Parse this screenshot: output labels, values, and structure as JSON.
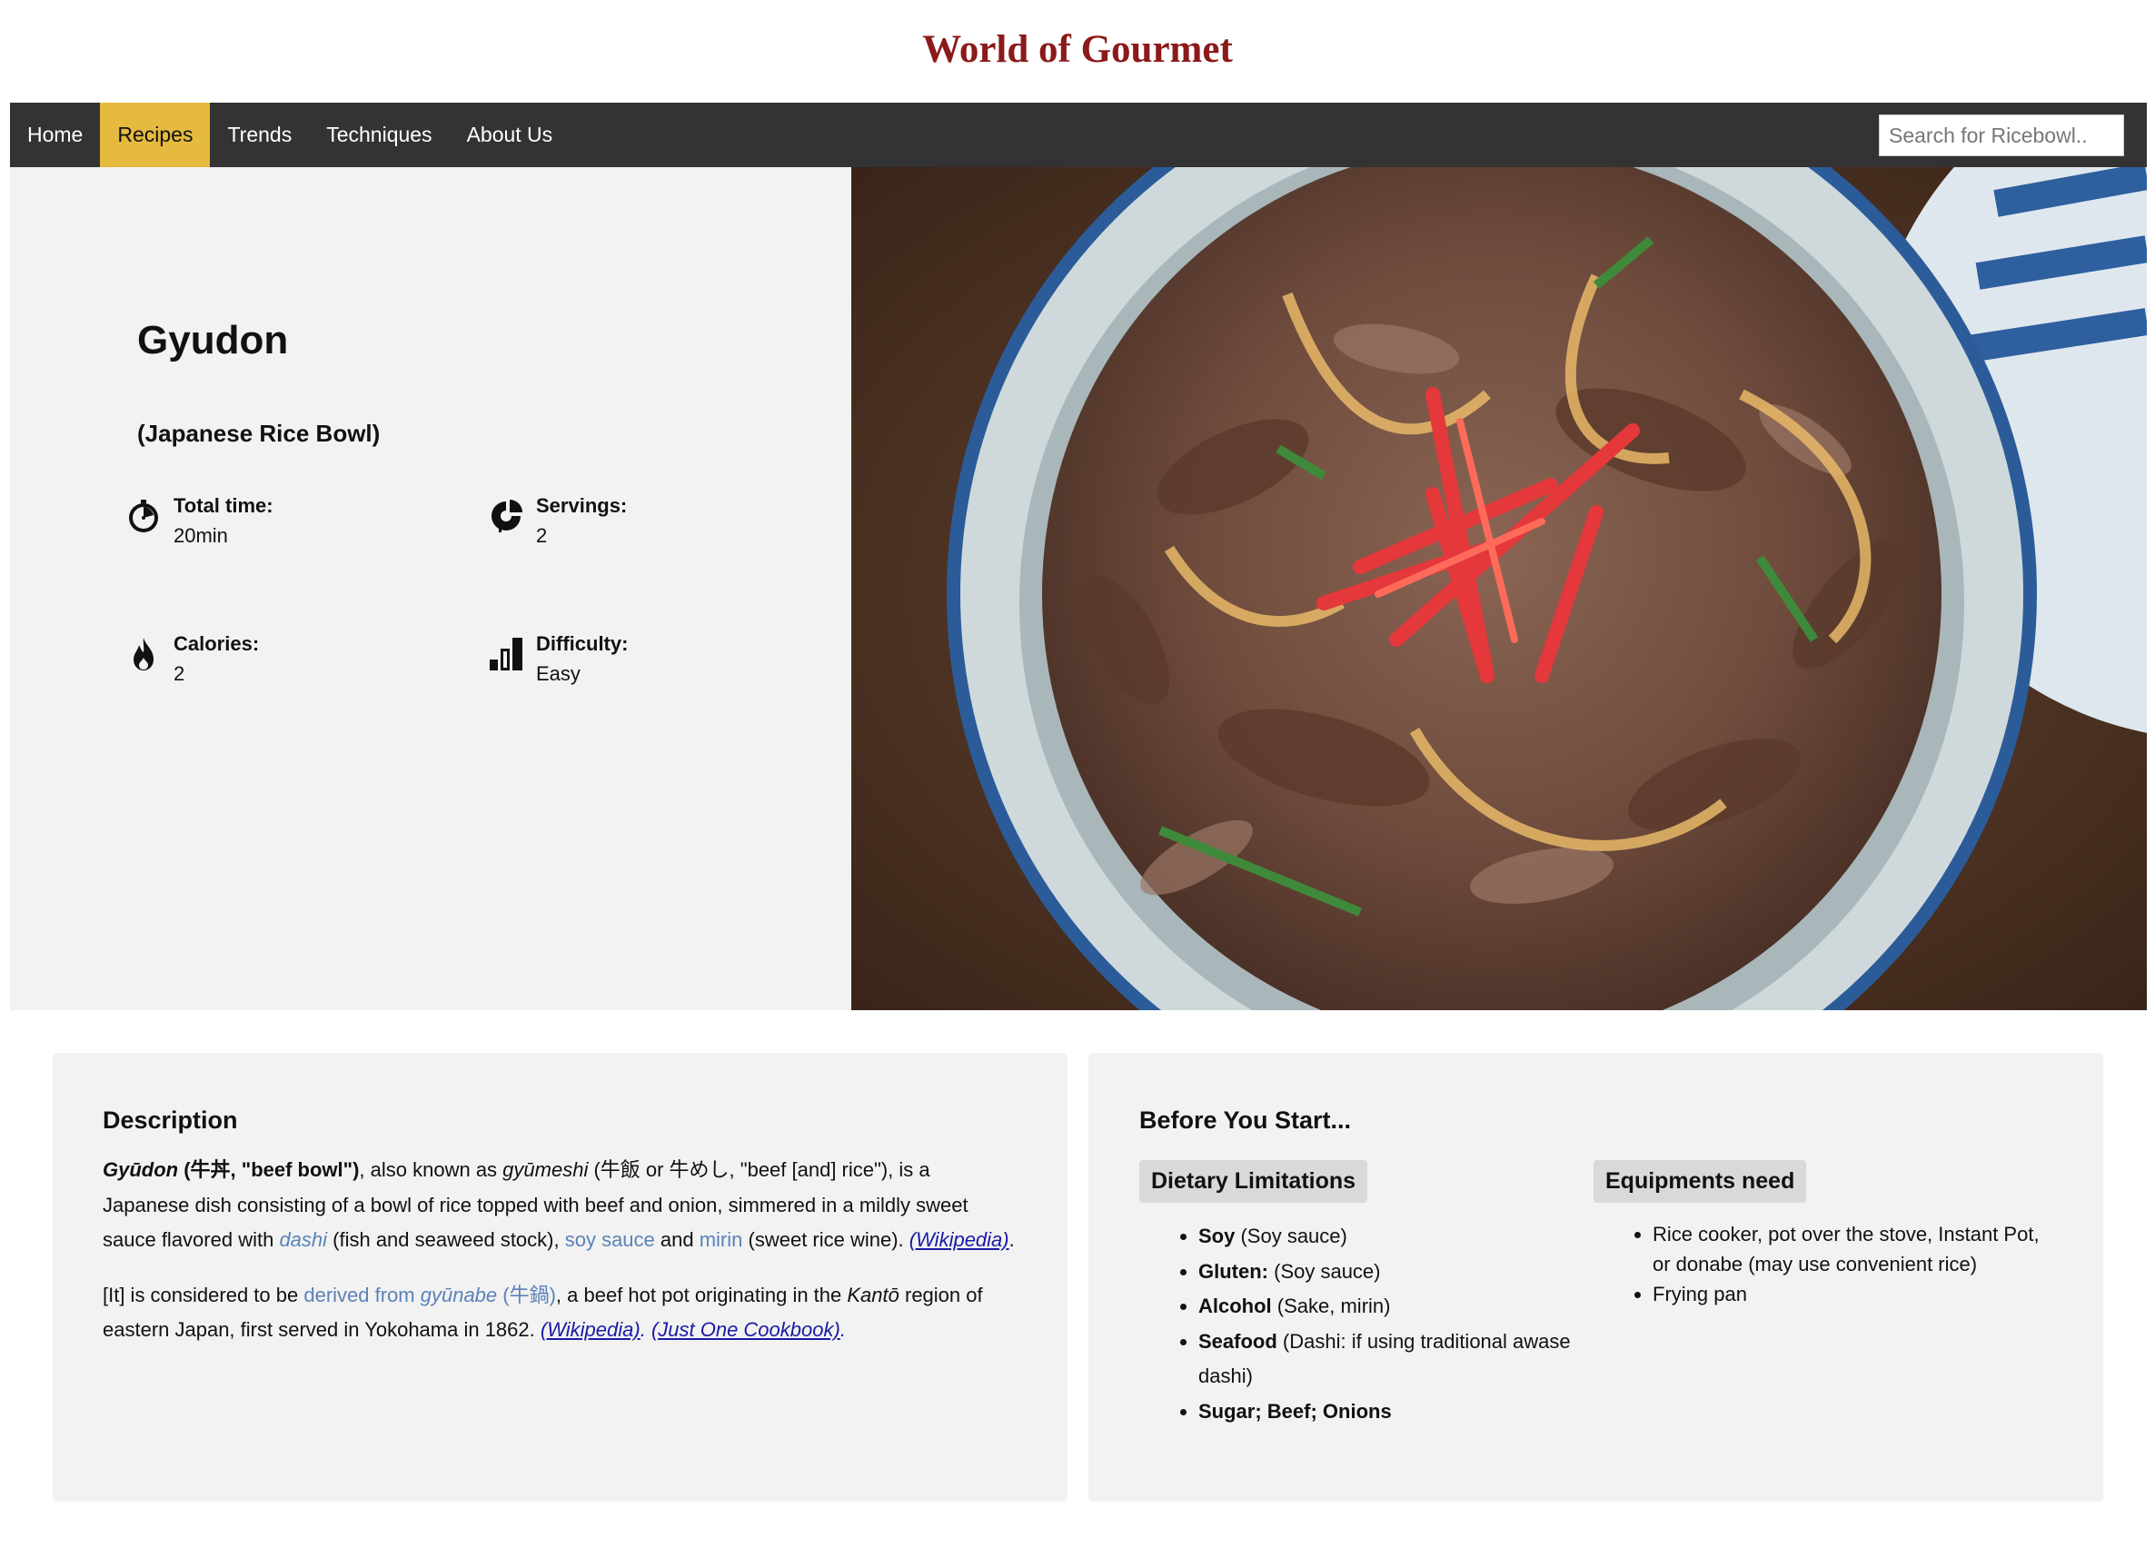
{
  "site": {
    "title": "World of Gourmet"
  },
  "nav": {
    "items": [
      "Home",
      "Recipes",
      "Trends",
      "Techniques",
      "About Us"
    ],
    "active": "Recipes",
    "search_placeholder": "Search for Ricebowl.."
  },
  "recipe": {
    "title": "Gyudon",
    "subtitle": "(Japanese Rice Bowl)",
    "stats": [
      {
        "icon": "stopwatch-icon",
        "label": "Total time:",
        "value": "20min"
      },
      {
        "icon": "servings-icon",
        "label": "Servings:",
        "value": "2"
      },
      {
        "icon": "flame-icon",
        "label": "Calories:",
        "value": "2"
      },
      {
        "icon": "bar-chart-icon",
        "label": "Difficulty:",
        "value": "Easy"
      }
    ],
    "image_alt": "Bowl of gyudon with beef, onion and pickled ginger"
  },
  "description": {
    "heading": "Description",
    "p1": {
      "term": "Gyūdon",
      "term_gloss": " (牛丼, \"beef bowl\")",
      "t1": ", also known as ",
      "alt_name": "gyūmeshi",
      "t2": " (牛飯 or 牛めし, \"beef [and] rice\"), is a Japanese dish consisting of a bowl of rice topped with beef and onion, simmered in a mildly sweet sauce flavored with ",
      "dashi": "dashi",
      "t3": " (fish and seaweed stock), ",
      "soy": "soy sauce",
      "t4": " and ",
      "mirin": "mirin",
      "t5": " (sweet rice wine). ",
      "ref": "(Wikipedia)",
      "t6": "."
    },
    "p2": {
      "t1": "[It] is considered to be ",
      "link_pre": "derived from ",
      "link_term": "gyūnabe",
      "link_kanji": " (牛鍋)",
      "t2": ", a beef hot pot originating in the ",
      "kanto": "Kantō",
      "t3": " region of eastern Japan, first served in Yokohama in 1862. ",
      "ref1": "(Wikipedia)",
      "sep": ". ",
      "ref2": "(Just One Cookbook)",
      "end": "."
    }
  },
  "before": {
    "heading": "Before You Start...",
    "dietary": {
      "label": "Dietary Limitations",
      "items": [
        {
          "name": "Soy",
          "detail": " (Soy sauce)"
        },
        {
          "name": "Gluten:",
          "detail": " (Soy sauce)"
        },
        {
          "name": "Alcohol",
          "detail": " (Sake, mirin)"
        },
        {
          "name": "Seafood",
          "detail": " (Dashi: if using traditional awase dashi)"
        },
        {
          "name": "Sugar; Beef; Onions",
          "detail": ""
        }
      ]
    },
    "equipment": {
      "label": "Equipments need",
      "items": [
        "Rice cooker, pot over the stove, Instant Pot, or donabe (may use convenient rice)",
        "Frying pan"
      ]
    }
  },
  "colors": {
    "brand": "#8b1a1a",
    "nav_bg": "#333333",
    "nav_active": "#e6b93f",
    "link_light": "#5b82b8",
    "link_ref": "#1a1aa6"
  }
}
